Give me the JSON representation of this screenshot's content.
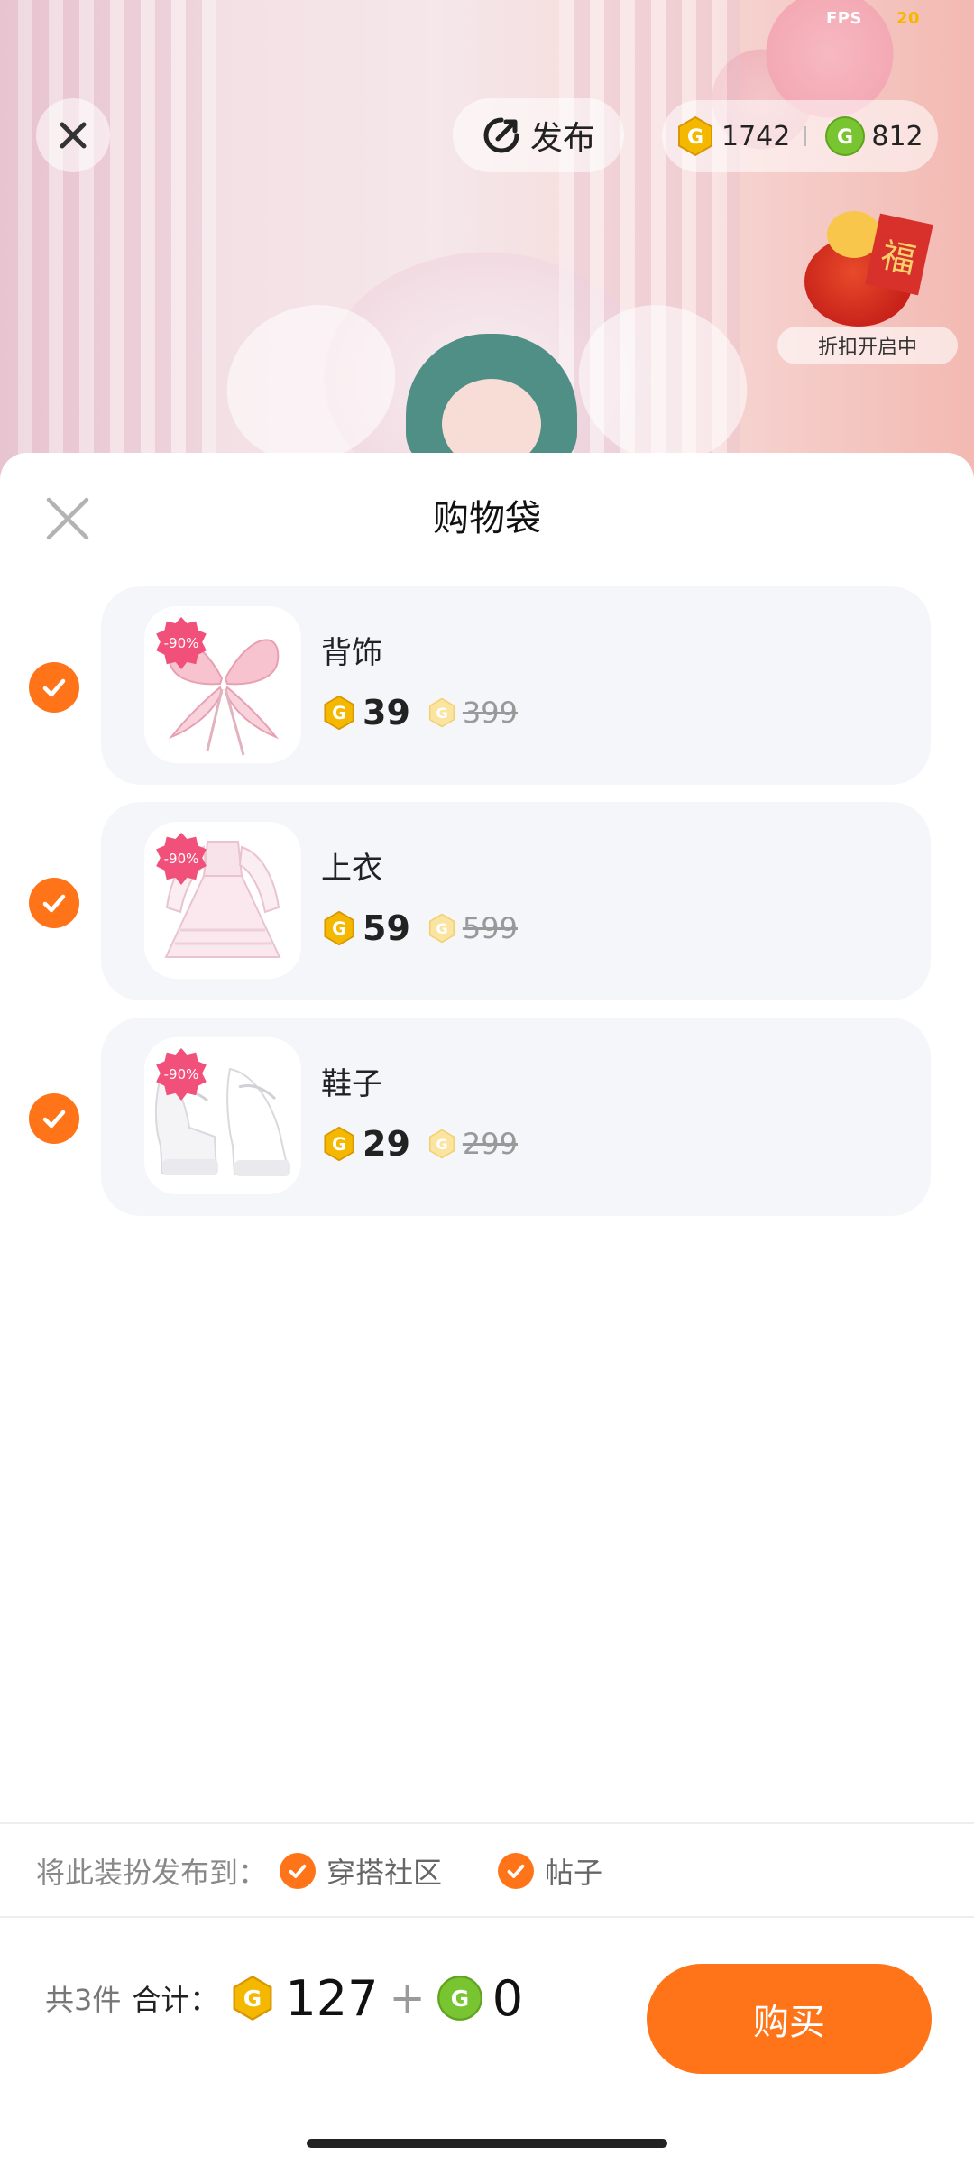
{
  "status": {
    "fps_label": "FPS",
    "fps_value": "20"
  },
  "topbar": {
    "publish_label": "发布",
    "gold_balance": "1742",
    "green_balance": "812",
    "discount_caption": "折扣开启中",
    "discount_glyph": "福"
  },
  "sheet": {
    "title": "购物袋",
    "items": [
      {
        "name": "背饰",
        "discount": "-90%",
        "price": "39",
        "original_price": "399",
        "checked": true
      },
      {
        "name": "上衣",
        "discount": "-90%",
        "price": "59",
        "original_price": "599",
        "checked": true
      },
      {
        "name": "鞋子",
        "discount": "-90%",
        "price": "29",
        "original_price": "299",
        "checked": true
      }
    ],
    "publish_to": {
      "label": "将此装扮发布到：",
      "options": [
        {
          "label": "穿搭社区",
          "checked": true
        },
        {
          "label": "帖子",
          "checked": true
        }
      ]
    },
    "footer": {
      "count": "共3件",
      "total_label": "合计：",
      "gold_total": "127",
      "plus": "+",
      "green_total": "0",
      "buy_label": "购买"
    }
  },
  "colors": {
    "accent": "#ff7419",
    "gold_coin": "#f5b800",
    "green_coin": "#79c431",
    "discount_tag": "#f0507a"
  }
}
